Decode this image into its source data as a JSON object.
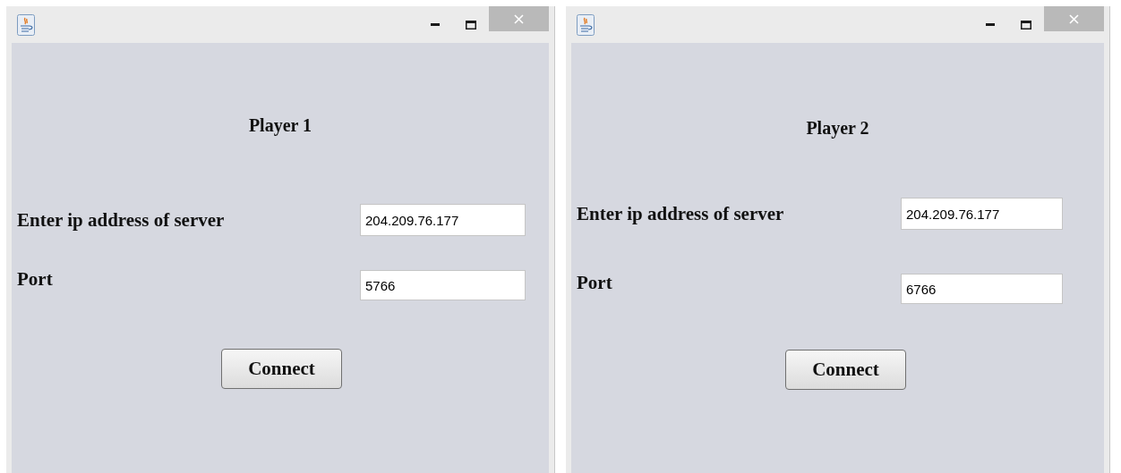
{
  "windows": [
    {
      "heading": "Player 1",
      "ip_label": "Enter ip address of server",
      "ip_value": "204.209.76.177",
      "port_label": "Port",
      "port_value": "5766",
      "button": "Connect"
    },
    {
      "heading": "Player 2",
      "ip_label": "Enter ip address of server",
      "ip_value": "204.209.76.177",
      "port_label": "Port",
      "port_value": "6766",
      "button": "Connect"
    }
  ]
}
